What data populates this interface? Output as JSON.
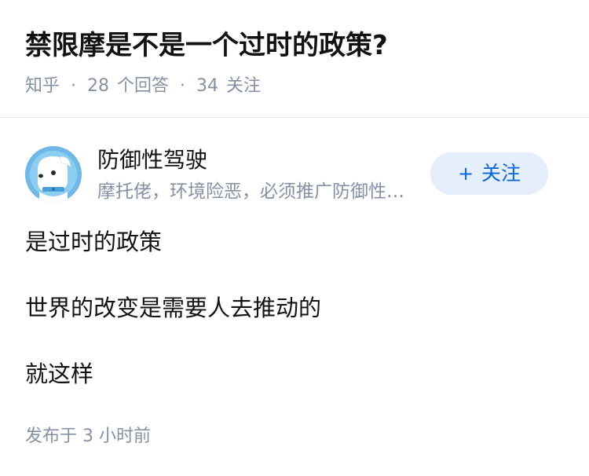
{
  "question": {
    "title": "禁限摩是不是一个过时的政策?",
    "source": "知乎",
    "answers_count": "28",
    "answers_label": "个回答",
    "followers_count": "34",
    "followers_label": "关注",
    "separator": "·"
  },
  "author": {
    "name": "防御性驾驶",
    "headline": "摩托佬，环境险恶，必须推广防御性驾驶",
    "avatar_icon": "cartoon-dog-avatar-icon",
    "follow_plus": "+",
    "follow_label": "关注",
    "follow_color": "#0a66e0",
    "follow_bg": "#e5eefb"
  },
  "answer": {
    "paragraphs": [
      "是过时的政策",
      "世界的改变是需要人去推动的",
      "就这样"
    ],
    "time": "发布于 3 小时前"
  },
  "colors": {
    "meta_text": "#8590a6",
    "primary_text": "#121212",
    "divider": "#ebebeb"
  }
}
